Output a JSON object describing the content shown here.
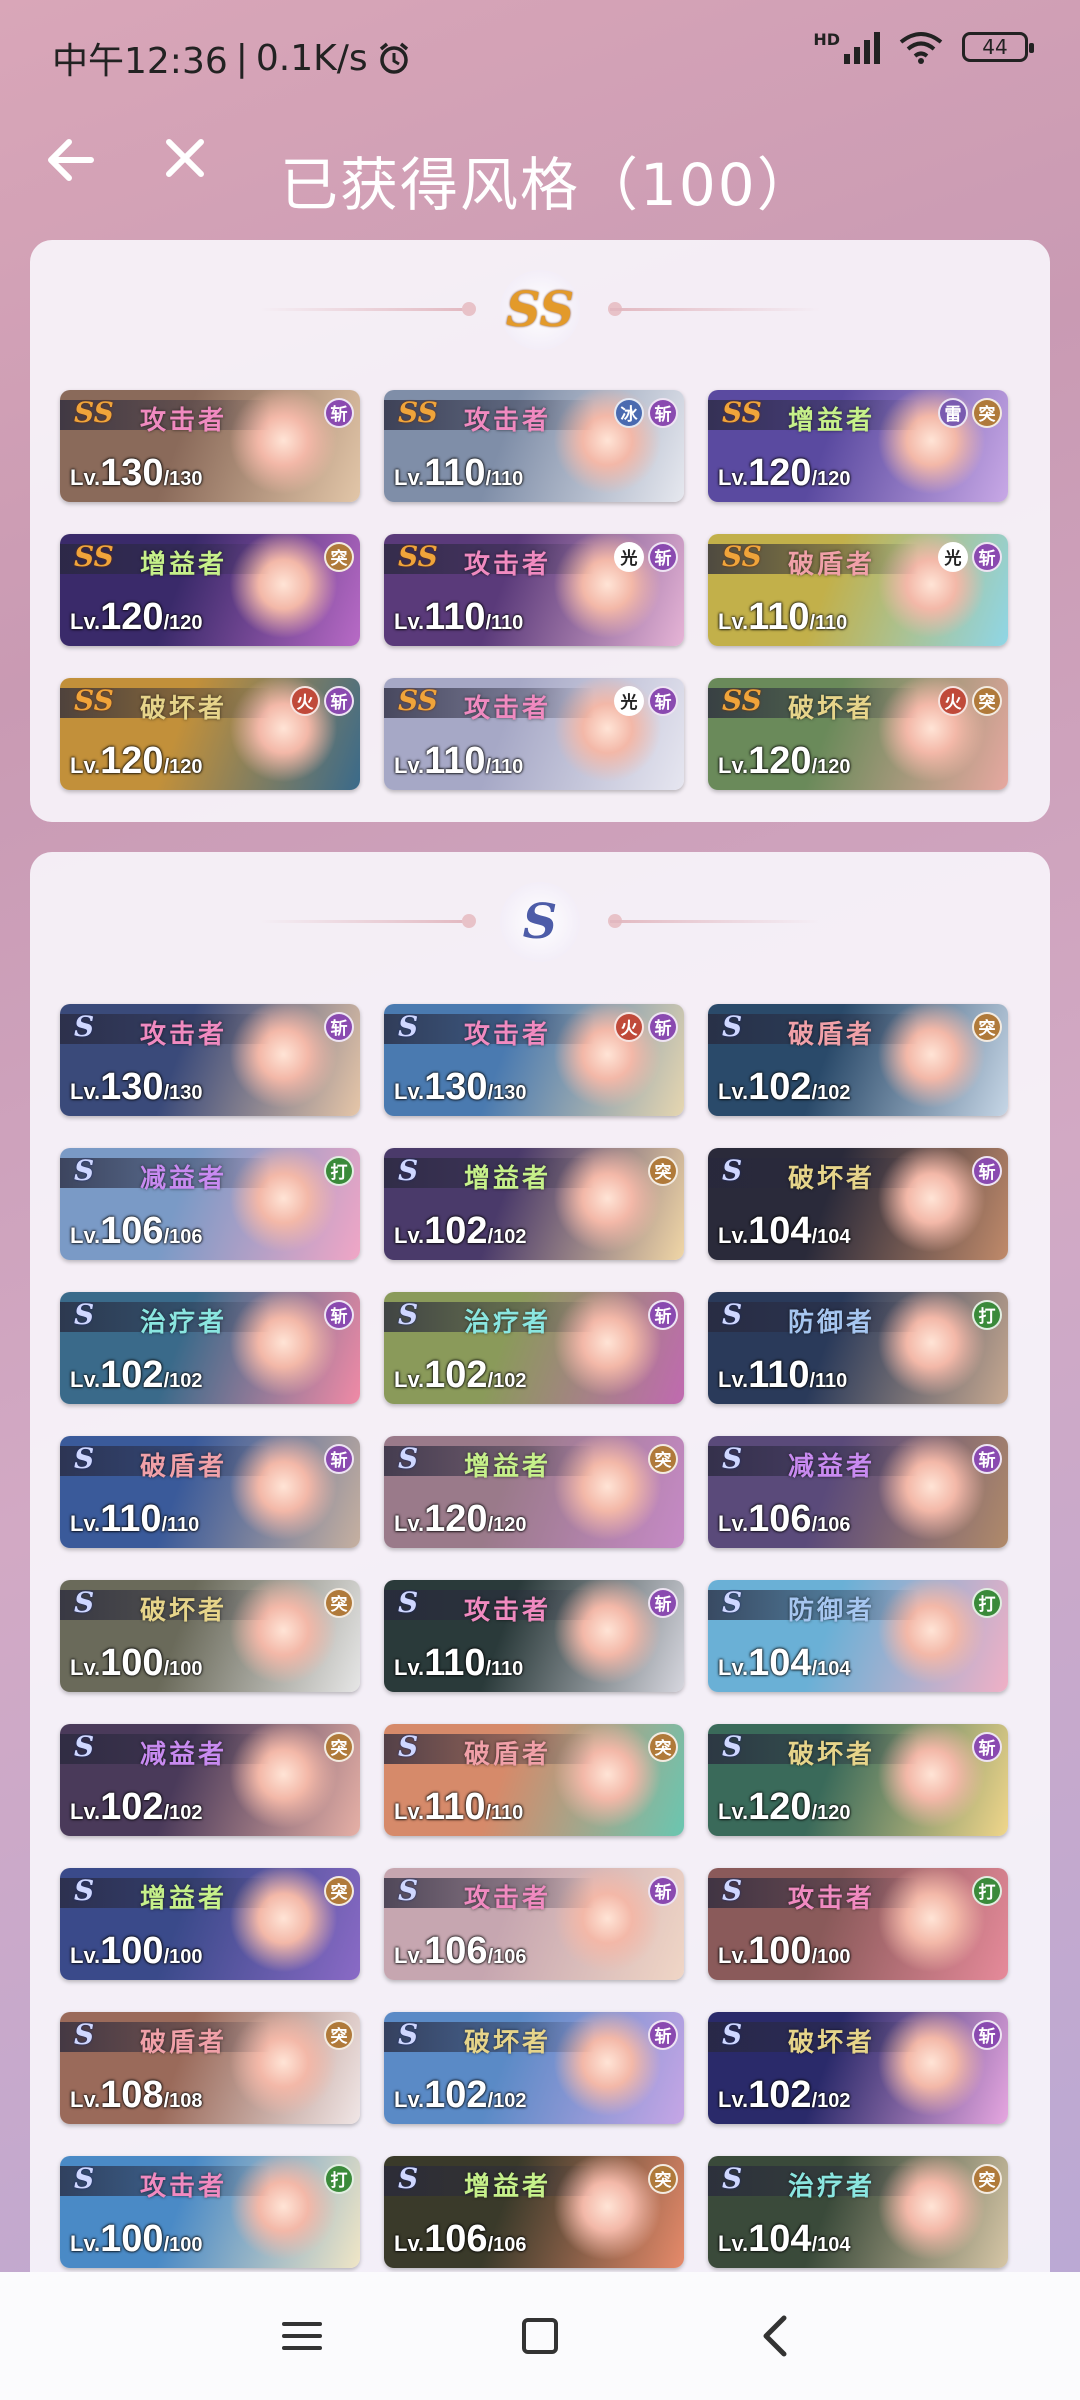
{
  "status_bar": {
    "time": "中午12:36",
    "speed": "0.1K/s",
    "network_label": "HD",
    "battery": "44"
  },
  "header": {
    "title": "已获得风格（100）"
  },
  "rank_labels": {
    "ss": "SS",
    "s": "S"
  },
  "level_prefix": "Lv.",
  "ss_styles": [
    {
      "role": "攻击者",
      "role_color": "#f08ac0",
      "level": "130",
      "max": "/130",
      "attrs": [
        "斩"
      ],
      "bg": "#8a6a5a",
      "bg2": "#e2c6a8"
    },
    {
      "role": "攻击者",
      "role_color": "#f08ac0",
      "level": "110",
      "max": "/110",
      "attrs": [
        "冰",
        "斩"
      ],
      "bg": "#7f8ea8",
      "bg2": "#e6e8ef"
    },
    {
      "role": "增益者",
      "role_color": "#c6f08a",
      "level": "120",
      "max": "/120",
      "attrs": [
        "雷",
        "突"
      ],
      "bg": "#5a4aa0",
      "bg2": "#c8a8e6"
    },
    {
      "role": "增益者",
      "role_color": "#c6f08a",
      "level": "120",
      "max": "/120",
      "attrs": [
        "突"
      ],
      "bg": "#3a2a6a",
      "bg2": "#b86ac6"
    },
    {
      "role": "攻击者",
      "role_color": "#f08ac0",
      "level": "110",
      "max": "/110",
      "attrs": [
        "光",
        "斩"
      ],
      "bg": "#5a3a7a",
      "bg2": "#e6b4d6"
    },
    {
      "role": "破盾者",
      "role_color": "#f0a0a8",
      "level": "110",
      "max": "/110",
      "attrs": [
        "光",
        "斩"
      ],
      "bg": "#c2b04a",
      "bg2": "#8fd6e6"
    },
    {
      "role": "破坏者",
      "role_color": "#e6d48a",
      "level": "120",
      "max": "/120",
      "attrs": [
        "火",
        "斩"
      ],
      "bg": "#c2903a",
      "bg2": "#3a6a8a"
    },
    {
      "role": "攻击者",
      "role_color": "#f08ac0",
      "level": "110",
      "max": "/110",
      "attrs": [
        "光",
        "斩"
      ],
      "bg": "#a6a8c6",
      "bg2": "#e6e6f0"
    },
    {
      "role": "破坏者",
      "role_color": "#e6d48a",
      "level": "120",
      "max": "/120",
      "attrs": [
        "火",
        "突"
      ],
      "bg": "#6a8a5a",
      "bg2": "#e6a8a0"
    }
  ],
  "s_styles": [
    {
      "role": "攻击者",
      "role_color": "#f08ac0",
      "level": "130",
      "max": "/130",
      "attrs": [
        "斩"
      ],
      "bg": "#3a4a7a",
      "bg2": "#e6c6a8"
    },
    {
      "role": "攻击者",
      "role_color": "#f08ac0",
      "level": "130",
      "max": "/130",
      "attrs": [
        "火",
        "斩"
      ],
      "bg": "#4a7ab0",
      "bg2": "#e6d6b0"
    },
    {
      "role": "破盾者",
      "role_color": "#f0a0a8",
      "level": "102",
      "max": "/102",
      "attrs": [
        "突"
      ],
      "bg": "#2a4a6a",
      "bg2": "#c6d6e6"
    },
    {
      "role": "减益者",
      "role_color": "#c88af0",
      "level": "106",
      "max": "/106",
      "attrs": [
        "打"
      ],
      "bg": "#7a9ac6",
      "bg2": "#f0a6c6"
    },
    {
      "role": "增益者",
      "role_color": "#c6f08a",
      "level": "102",
      "max": "/102",
      "attrs": [
        "突"
      ],
      "bg": "#4a3a6a",
      "bg2": "#f0d6a6"
    },
    {
      "role": "破坏者",
      "role_color": "#e6d48a",
      "level": "104",
      "max": "/104",
      "attrs": [
        "斩"
      ],
      "bg": "#2a2a3a",
      "bg2": "#c08a6a"
    },
    {
      "role": "治疗者",
      "role_color": "#8ae6e0",
      "level": "102",
      "max": "/102",
      "attrs": [
        "斩"
      ],
      "bg": "#3a6a8a",
      "bg2": "#f08aa6"
    },
    {
      "role": "治疗者",
      "role_color": "#8ae6e0",
      "level": "102",
      "max": "/102",
      "attrs": [
        "斩"
      ],
      "bg": "#8a9a5a",
      "bg2": "#c06ab0"
    },
    {
      "role": "防御者",
      "role_color": "#a6c6f0",
      "level": "110",
      "max": "/110",
      "attrs": [
        "打"
      ],
      "bg": "#2a3a5a",
      "bg2": "#c6a890"
    },
    {
      "role": "破盾者",
      "role_color": "#f0a0a8",
      "level": "110",
      "max": "/110",
      "attrs": [
        "斩"
      ],
      "bg": "#3a5a9a",
      "bg2": "#c6b0a0"
    },
    {
      "role": "增益者",
      "role_color": "#c6f08a",
      "level": "120",
      "max": "/120",
      "attrs": [
        "突"
      ],
      "bg": "#9a7a8a",
      "bg2": "#c68ac6"
    },
    {
      "role": "减益者",
      "role_color": "#c88af0",
      "level": "106",
      "max": "/106",
      "attrs": [
        "斩"
      ],
      "bg": "#5a4a7a",
      "bg2": "#b08a6a"
    },
    {
      "role": "破坏者",
      "role_color": "#e6d48a",
      "level": "100",
      "max": "/100",
      "attrs": [
        "突"
      ],
      "bg": "#6a6a5a",
      "bg2": "#e6e6e6"
    },
    {
      "role": "攻击者",
      "role_color": "#f08ac0",
      "level": "110",
      "max": "/110",
      "attrs": [
        "斩"
      ],
      "bg": "#2a3a3a",
      "bg2": "#d6d6de"
    },
    {
      "role": "防御者",
      "role_color": "#a6c6f0",
      "level": "104",
      "max": "/104",
      "attrs": [
        "打"
      ],
      "bg": "#6ab0d6",
      "bg2": "#f0b0c6"
    },
    {
      "role": "减益者",
      "role_color": "#c88af0",
      "level": "102",
      "max": "/102",
      "attrs": [
        "突"
      ],
      "bg": "#4a3a5a",
      "bg2": "#e6b0a6"
    },
    {
      "role": "破盾者",
      "role_color": "#f0a0a8",
      "level": "110",
      "max": "/110",
      "attrs": [
        "突"
      ],
      "bg": "#d68a6a",
      "bg2": "#6ac6b0"
    },
    {
      "role": "破坏者",
      "role_color": "#e6d48a",
      "level": "120",
      "max": "/120",
      "attrs": [
        "斩"
      ],
      "bg": "#3a6a5a",
      "bg2": "#f0d68a"
    },
    {
      "role": "增益者",
      "role_color": "#c6f08a",
      "level": "100",
      "max": "/100",
      "attrs": [
        "突"
      ],
      "bg": "#3a4a8a",
      "bg2": "#8a6ac6"
    },
    {
      "role": "攻击者",
      "role_color": "#f08ac0",
      "level": "106",
      "max": "/106",
      "attrs": [
        "斩"
      ],
      "bg": "#c6a6b0",
      "bg2": "#f0d6c6"
    },
    {
      "role": "攻击者",
      "role_color": "#f08ac0",
      "level": "100",
      "max": "/100",
      "attrs": [
        "打"
      ],
      "bg": "#8a5a5a",
      "bg2": "#e68a9a"
    },
    {
      "role": "破盾者",
      "role_color": "#f0a0a8",
      "level": "108",
      "max": "/108",
      "attrs": [
        "突"
      ],
      "bg": "#9a6a5a",
      "bg2": "#f0e6e6"
    },
    {
      "role": "破坏者",
      "role_color": "#e6d48a",
      "level": "102",
      "max": "/102",
      "attrs": [
        "斩"
      ],
      "bg": "#5a8ac6",
      "bg2": "#c6a6e6"
    },
    {
      "role": "破坏者",
      "role_color": "#e6d48a",
      "level": "102",
      "max": "/102",
      "attrs": [
        "斩"
      ],
      "bg": "#2a2a6a",
      "bg2": "#e6a6e0"
    },
    {
      "role": "攻击者",
      "role_color": "#f08ac0",
      "level": "100",
      "max": "/100",
      "attrs": [
        "打"
      ],
      "bg": "#4a8ac6",
      "bg2": "#f0e6c6"
    },
    {
      "role": "增益者",
      "role_color": "#c6f08a",
      "level": "106",
      "max": "/106",
      "attrs": [
        "突"
      ],
      "bg": "#3a3a2a",
      "bg2": "#e68a6a"
    },
    {
      "role": "治疗者",
      "role_color": "#8ae6e0",
      "level": "104",
      "max": "/104",
      "attrs": [
        "突"
      ],
      "bg": "#3a4a3a",
      "bg2": "#d6c6a6"
    }
  ],
  "attr_colors": {
    "斩": "#8a4ab0",
    "突": "#b07a3a",
    "打": "#3a8a3a",
    "冰": "#4a6ab0",
    "雷": "#7a5ab0",
    "光": "#ffffff",
    "火": "#c04a3a"
  },
  "nav": {
    "menu": "menu-icon",
    "home": "home-icon",
    "back": "back-icon"
  }
}
